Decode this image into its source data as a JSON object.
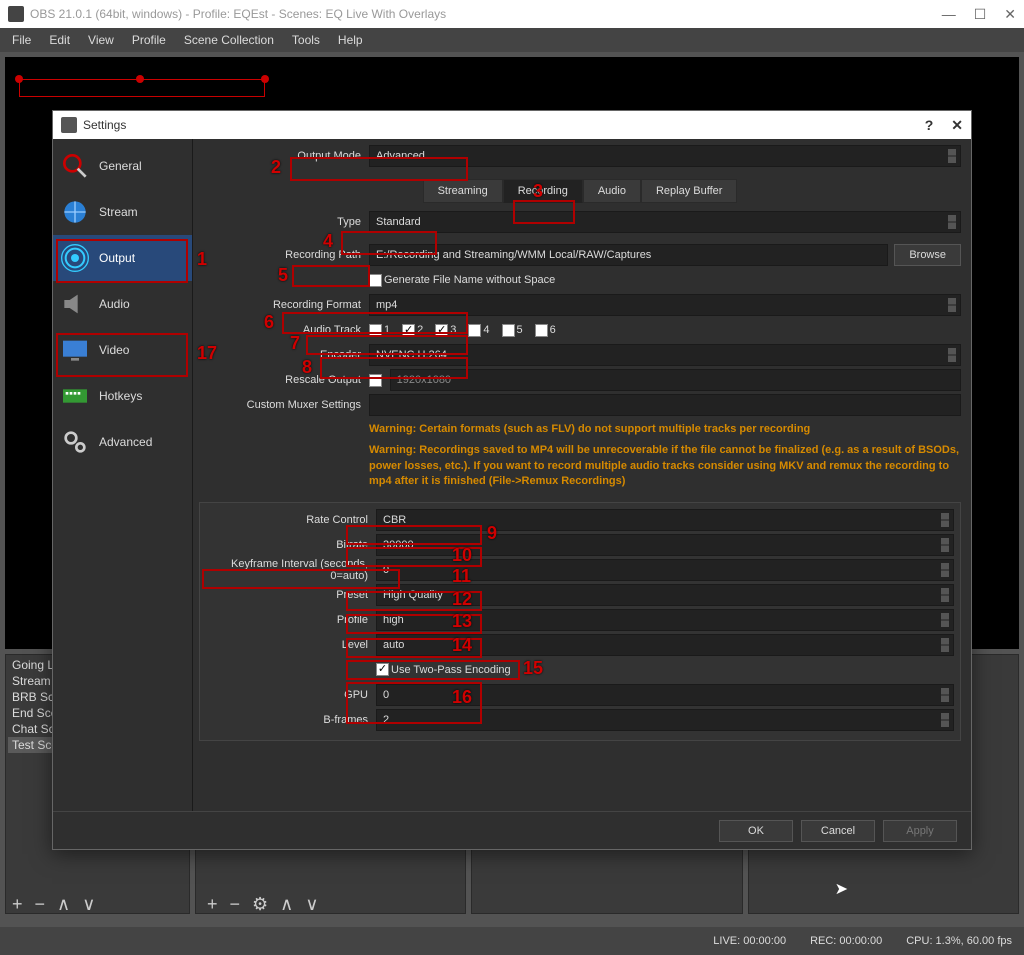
{
  "window": {
    "title": "OBS 21.0.1 (64bit, windows) - Profile: EQEst - Scenes: EQ Live With Overlays"
  },
  "menu": [
    "File",
    "Edit",
    "View",
    "Profile",
    "Scene Collection",
    "Tools",
    "Help"
  ],
  "scenes": [
    "Going L",
    "Stream",
    "BRB Sce",
    "End Sce",
    "Chat Sc",
    "Test Sce"
  ],
  "status": {
    "live": "LIVE: 00:00:00",
    "rec": "REC: 00:00:00",
    "cpu": "CPU: 1.3%, 60.00 fps"
  },
  "dialog": {
    "title": "Settings",
    "sidebar": [
      {
        "label": "General"
      },
      {
        "label": "Stream"
      },
      {
        "label": "Output"
      },
      {
        "label": "Audio"
      },
      {
        "label": "Video"
      },
      {
        "label": "Hotkeys"
      },
      {
        "label": "Advanced"
      }
    ],
    "output_mode_label": "Output Mode",
    "output_mode_value": "Advanced",
    "tabs": [
      "Streaming",
      "Recording",
      "Audio",
      "Replay Buffer"
    ],
    "type_label": "Type",
    "type_value": "Standard",
    "recording_path_label": "Recording Path",
    "recording_path_value": "E:/Recording and Streaming/WMM Local/RAW/Captures",
    "browse_label": "Browse",
    "gen_filename_label": "Generate File Name without Space",
    "recording_format_label": "Recording Format",
    "recording_format_value": "mp4",
    "audio_track_label": "Audio Track",
    "tracks": [
      "1",
      "2",
      "3",
      "4",
      "5",
      "6"
    ],
    "encoder_label": "Encoder",
    "encoder_value": "NVENC H.264",
    "rescale_label": "Rescale Output",
    "rescale_value": "1920x1080",
    "muxer_label": "Custom Muxer Settings",
    "warning1": "Warning: Certain formats (such as FLV) do not support multiple tracks per recording",
    "warning2": "Warning: Recordings saved to MP4 will be unrecoverable if the file cannot be finalized (e.g. as a result of BSODs, power losses, etc.). If you want to record multiple audio tracks consider using MKV and remux the recording to mp4 after it is finished (File->Remux Recordings)",
    "rate_control_label": "Rate Control",
    "rate_control_value": "CBR",
    "bitrate_label": "Bitrate",
    "bitrate_value": "30000",
    "keyframe_label": "Keyframe Interval (seconds, 0=auto)",
    "keyframe_value": "0",
    "preset_label": "Preset",
    "preset_value": "High Quality",
    "profile_label": "Profile",
    "profile_value": "high",
    "level_label": "Level",
    "level_value": "auto",
    "twopass_label": "Use Two-Pass Encoding",
    "gpu_label": "GPU",
    "gpu_value": "0",
    "bframes_label": "B-frames",
    "bframes_value": "2",
    "ok": "OK",
    "cancel": "Cancel",
    "apply": "Apply"
  },
  "annotations": {
    "n1": "1",
    "n2": "2",
    "n3": "3",
    "n4": "4",
    "n5": "5",
    "n6": "6",
    "n7": "7",
    "n8": "8",
    "n9": "9",
    "n10": "10",
    "n11": "11",
    "n12": "12",
    "n13": "13",
    "n14": "14",
    "n15": "15",
    "n16": "16",
    "n17": "17"
  }
}
